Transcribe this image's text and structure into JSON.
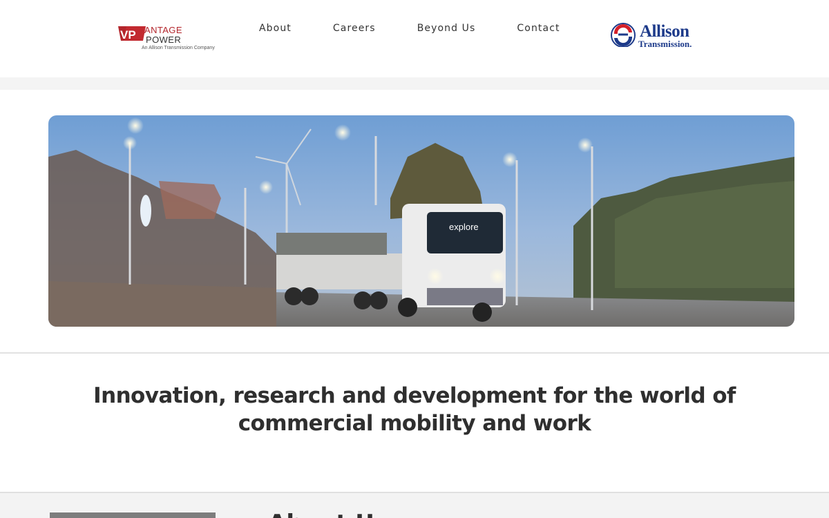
{
  "header": {
    "brand_logo_text": "VANTAGE POWER",
    "brand_sub": "An Allison Transmission Company",
    "nav": [
      {
        "label": "About"
      },
      {
        "label": "Careers"
      },
      {
        "label": "Beyond Us"
      },
      {
        "label": "Contact"
      }
    ],
    "partner_logo_line1": "Allison",
    "partner_logo_line2": "Transmission."
  },
  "hero": {
    "truck_text": "explore"
  },
  "tagline": "Innovation, research and development for the world of commercial mobility and work",
  "about": {
    "heading": "About Us"
  },
  "colors": {
    "brand_red": "#b3262c",
    "partner_blue": "#1d3a8a",
    "partner_red": "#d4202a",
    "text": "#2f2f2f"
  }
}
